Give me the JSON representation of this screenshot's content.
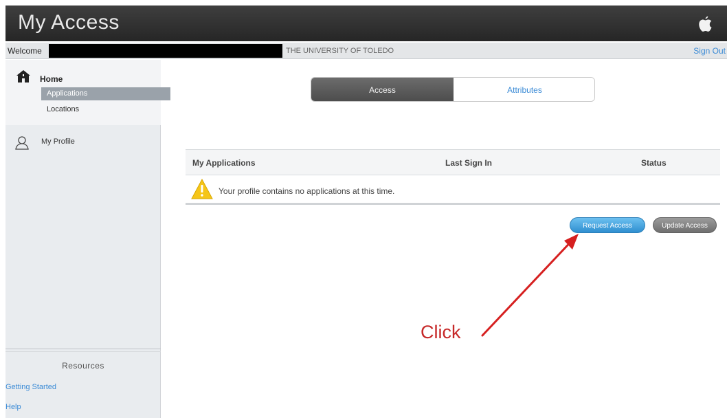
{
  "header": {
    "title": "My Access",
    "logo_icon": "apple-logo-icon"
  },
  "welcome_bar": {
    "welcome_label": "Welcome",
    "university": "THE UNIVERSITY OF TOLEDO",
    "sign_out": "Sign Out"
  },
  "sidebar": {
    "home_label": "Home",
    "items": [
      {
        "label": "Applications",
        "selected": true
      },
      {
        "label": "Locations",
        "selected": false
      }
    ],
    "profile_label": "My Profile",
    "resources": {
      "title": "Resources",
      "links": [
        "Getting Started",
        "Help"
      ]
    }
  },
  "tabs": [
    {
      "label": "Access",
      "active": true
    },
    {
      "label": "Attributes",
      "active": false
    }
  ],
  "table": {
    "columns": [
      "My Applications",
      "Last Sign In",
      "Status"
    ],
    "empty_message": "Your profile contains no applications at this time."
  },
  "buttons": {
    "request_access": "Request Access",
    "update_access": "Update Access"
  },
  "annotation": {
    "text": "Click",
    "color": "#c62828"
  },
  "colors": {
    "link": "#3b8bd6",
    "header_bg": "#2f2f2f",
    "request_button": "#3a9ad9",
    "update_button": "#7d7d7d"
  }
}
